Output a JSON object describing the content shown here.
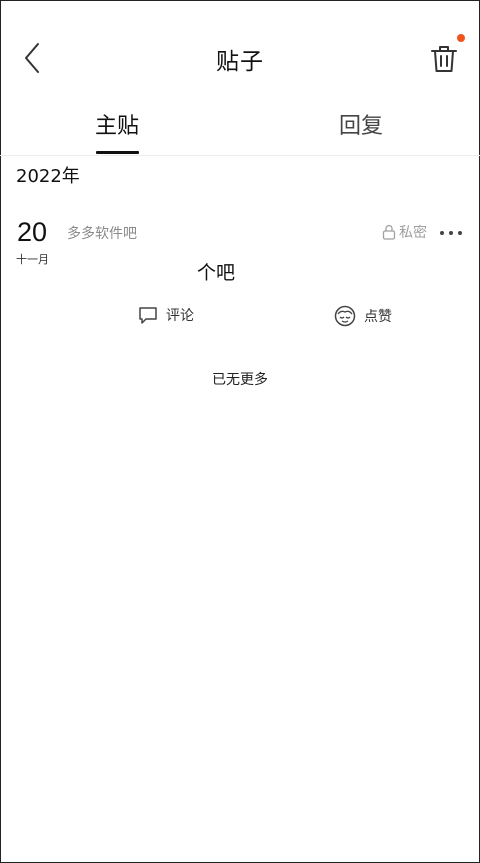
{
  "header": {
    "title": "贴子",
    "back_icon": "chevron-left-icon",
    "trash_icon": "trash-icon",
    "notification_color": "#f0531c"
  },
  "tabs": [
    {
      "label": "主贴",
      "active": true
    },
    {
      "label": "回复",
      "active": false
    }
  ],
  "content": {
    "year": "2022年",
    "post": {
      "day": "20",
      "month": "十一月",
      "forum": "多多软件吧",
      "privacy_label": "私密",
      "title": "个吧",
      "comment_label": "评论",
      "like_label": "点赞"
    },
    "end_text": "已无更多"
  }
}
